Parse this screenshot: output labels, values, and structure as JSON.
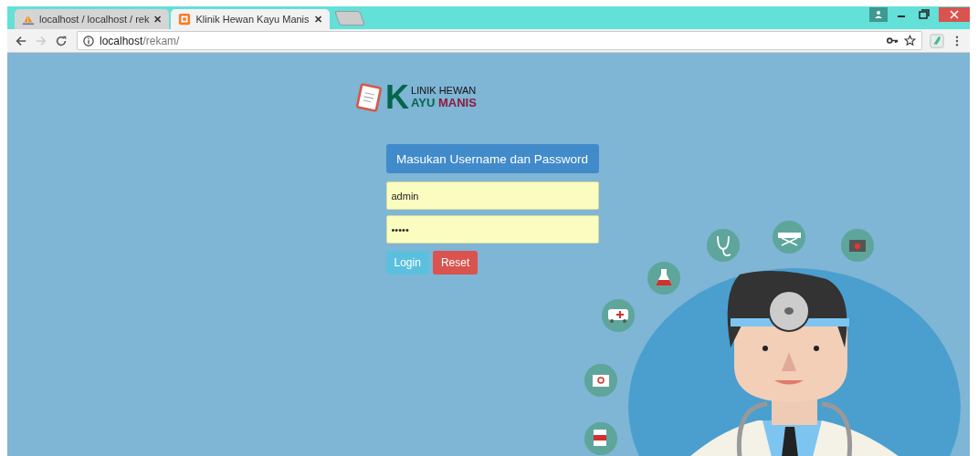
{
  "browser": {
    "tabs": [
      {
        "title": "localhost / localhost / rek",
        "selected": false,
        "close": "✕"
      },
      {
        "title": "Klinik Hewan Kayu Manis",
        "selected": true,
        "close": "✕"
      }
    ],
    "address": {
      "host": "localhost",
      "path": "/rekam/"
    }
  },
  "logo": {
    "initial": "K",
    "top": "LINIK HEWAN",
    "bottom_1": "AYU",
    "bottom_2": "MANIS"
  },
  "login": {
    "heading": "Masukan Username dan Password",
    "username": "admin",
    "password": "•••••",
    "buttons": [
      {
        "label": "Login",
        "kind": "primary"
      },
      {
        "label": "Reset",
        "kind": "danger"
      }
    ]
  }
}
